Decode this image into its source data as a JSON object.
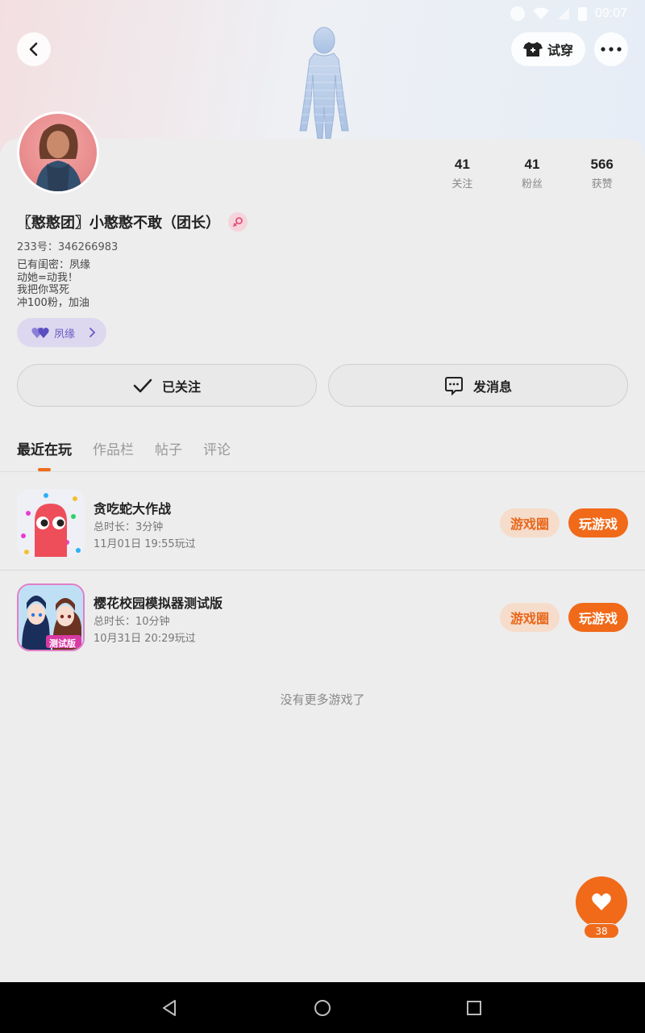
{
  "status_bar": {
    "time": "09:07"
  },
  "header": {
    "tryon_label": "试穿"
  },
  "profile": {
    "nickname": "〖憨憨团〗小憨憨不敢（团长）",
    "uid": "233号：346266983",
    "bio": [
      "已有闺密：夙缘",
      "动她=动我！",
      "我把你骂死",
      "冲100粉，加油"
    ],
    "bff_tag": "夙缘",
    "stats": [
      {
        "value": "41",
        "label": "关注"
      },
      {
        "value": "41",
        "label": "粉丝"
      },
      {
        "value": "566",
        "label": "获赞"
      }
    ]
  },
  "actions": {
    "follow_label": "已关注",
    "message_label": "发消息"
  },
  "tabs": [
    "最近在玩",
    "作品栏",
    "帖子",
    "评论"
  ],
  "games": [
    {
      "title": "贪吃蛇大作战",
      "duration": "总时长：3分钟",
      "last_played": "11月01日 19:55玩过",
      "circle_label": "游戏圈",
      "play_label": "玩游戏"
    },
    {
      "title": "樱花校园模拟器测试版",
      "duration": "总时长：10分钟",
      "last_played": "10月31日 20:29玩过",
      "circle_label": "游戏圈",
      "play_label": "玩游戏",
      "icon_badge": "测试版"
    }
  ],
  "no_more_text": "没有更多游戏了",
  "like_count": "38",
  "colors": {
    "accent": "#f06a1a",
    "accent_light": "#f6dccb",
    "bff": "#6a5bc4"
  }
}
